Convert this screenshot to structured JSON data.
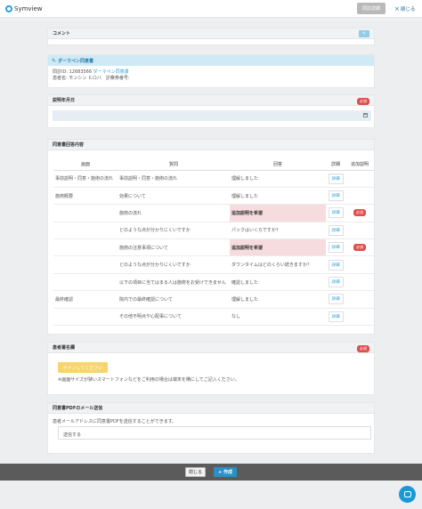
{
  "topbar": {
    "brand": "Symview",
    "question_detail": "問診詳細",
    "close": "閉じる"
  },
  "comment": {
    "title": "コメント",
    "edit_icon": "pencil-icon"
  },
  "questionnaire": {
    "title": "ダーマペン同意書",
    "id_label": "問診ID: 12683566",
    "id_link": "ダーマペン同意書",
    "patient": "患者名: モンシン ヒロバ　診察券番号:"
  },
  "explained_date": {
    "title": "説明年月日",
    "required": "必須"
  },
  "consent": {
    "title": "同意書回答内容",
    "headers": {
      "screen": "画面",
      "question": "質問",
      "answer": "回答",
      "detail": "詳細",
      "extra": "追加説明"
    },
    "rows": [
      {
        "screen": "事前説明・同意・施術の流れ",
        "question": "事前説明・同意・施術の流れ",
        "answer": "理解しました",
        "alert": false,
        "detail": "詳細",
        "extra": ""
      },
      {
        "screen": "施術概要",
        "question": "効果について",
        "answer": "理解しました",
        "alert": false,
        "detail": "詳細",
        "extra": ""
      },
      {
        "screen": "",
        "question": "施術の流れ",
        "answer": "追加説明を希望",
        "alert": true,
        "detail": "詳細",
        "extra": "必須"
      },
      {
        "screen": "",
        "question": "どのような点が分かりにくいですか",
        "answer": "パックはいくらですか？",
        "alert": false,
        "detail": "詳細",
        "extra": ""
      },
      {
        "screen": "",
        "question": "施術の注意事項について",
        "answer": "追加説明を希望",
        "alert": true,
        "detail": "詳細",
        "extra": "必須"
      },
      {
        "screen": "",
        "question": "どのような点が分かりにくいですか",
        "answer": "ダウンタイムはどのくらい続きますか？",
        "alert": false,
        "detail": "詳細",
        "extra": ""
      },
      {
        "screen": "",
        "question": "以下の項目に当てはまる人は施術をお受けできません",
        "answer": "確認しました",
        "alert": false,
        "detail": "詳細",
        "extra": ""
      },
      {
        "screen": "最終確認",
        "question": "院内での最終確認について",
        "answer": "理解しました",
        "alert": false,
        "detail": "詳細",
        "extra": ""
      },
      {
        "screen": "",
        "question": "その他不明点や心配事について",
        "answer": "なし",
        "alert": false,
        "detail": "詳細",
        "extra": ""
      }
    ]
  },
  "signature": {
    "title": "患者署名欄",
    "required": "必須",
    "button": "サインしてください",
    "note": "※画面サイズが狭いスマートフォンなどをご利用の場合は端末を横にしてご記入ください。"
  },
  "pdf": {
    "title": "同意書PDFのメール送信",
    "desc": "患者メールアドレスに同意書PDFを送信することができます。",
    "send": "送信する"
  },
  "footer": {
    "close": "閉じる",
    "create": "+ 作成"
  },
  "colors": {
    "primary": "#2b8fc6",
    "alert_bg": "#f6dcdf",
    "required": "#e24c4b",
    "sign": "#f6d56b"
  }
}
